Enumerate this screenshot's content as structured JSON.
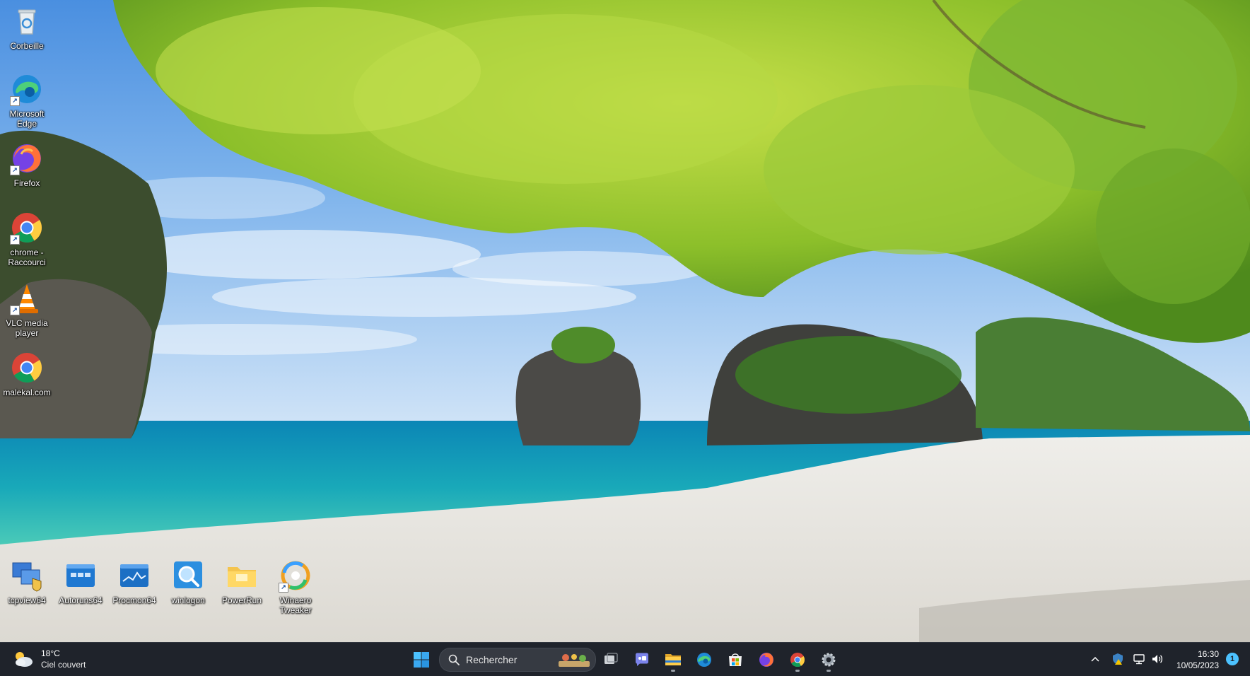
{
  "desktop_icons_left": [
    {
      "id": "corbeille",
      "label": "Corbeille"
    },
    {
      "id": "edge",
      "label": "Microsoft Edge"
    },
    {
      "id": "firefox",
      "label": "Firefox"
    },
    {
      "id": "chrome",
      "label": "chrome - Raccourci"
    },
    {
      "id": "vlc",
      "label": "VLC media player"
    },
    {
      "id": "malekal",
      "label": "malekal.com"
    }
  ],
  "desktop_icons_bottom": [
    {
      "id": "tcpview",
      "label": "tcpview64"
    },
    {
      "id": "autoruns",
      "label": "Autoruns64"
    },
    {
      "id": "procmon",
      "label": "Procmon64"
    },
    {
      "id": "winlogon",
      "label": "winlogon"
    },
    {
      "id": "powerrun",
      "label": "PowerRun"
    },
    {
      "id": "winaero",
      "label": "Winaero Tweaker"
    }
  ],
  "taskbar": {
    "weather": {
      "temp": "18°C",
      "desc": "Ciel couvert",
      "icon": "cloudy-sun-icon"
    },
    "search_placeholder": "Rechercher",
    "pinned": [
      "start-button",
      "search-box",
      "task-view",
      "teams-chat",
      "file-explorer",
      "edge",
      "microsoft-store",
      "firefox",
      "chrome",
      "settings"
    ],
    "clock": {
      "time": "16:30",
      "date": "10/05/2023"
    },
    "notification_count": "1"
  },
  "colors": {
    "taskbar_bg": "#1f232b",
    "accent": "#4cc2ff"
  }
}
